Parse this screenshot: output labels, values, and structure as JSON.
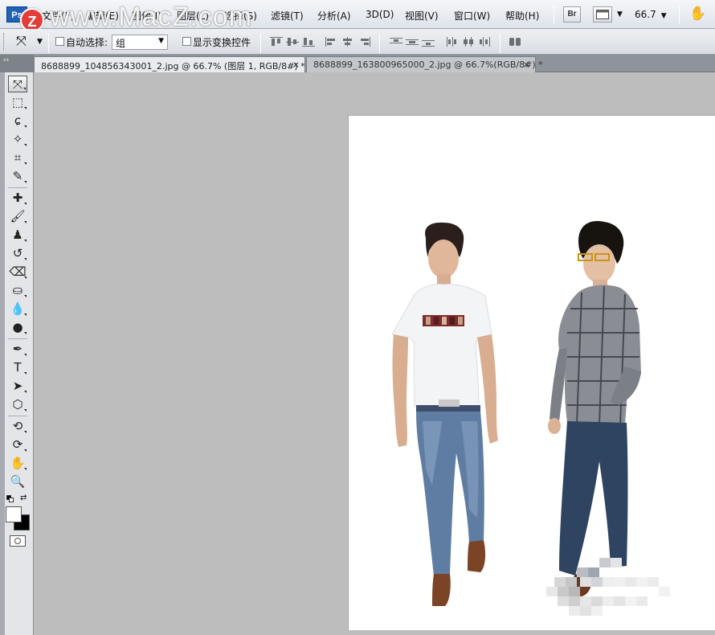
{
  "app": {
    "logo_text": "Ps",
    "zoom_value": "66.7"
  },
  "watermark": {
    "badge": "Z",
    "text": "www.MacZ.com"
  },
  "menu": {
    "items": [
      "文件(F)",
      "编辑(E)",
      "图像(I)",
      "图层(L)",
      "选择(S)",
      "滤镜(T)",
      "分析(A)",
      "3D(D)",
      "视图(V)",
      "窗口(W)",
      "帮助(H)"
    ]
  },
  "appbar": {
    "bridge_label": "Br"
  },
  "options": {
    "auto_select_label": "自动选择:",
    "auto_select_value": "组",
    "transform_label": "显示变换控件"
  },
  "tabs": [
    {
      "label": "8688899_104856343001_2.jpg @ 66.7% (图层 1, RGB/8#) *",
      "close": "×"
    },
    {
      "label": "8688899_163800965000_2.jpg @ 66.7%(RGB/8#) *",
      "close": "×"
    }
  ],
  "toolbox": {
    "header": "››",
    "tools": [
      {
        "name": "move-tool",
        "glyph": "⤧"
      },
      {
        "name": "marquee-tool",
        "glyph": "⬚"
      },
      {
        "name": "lasso-tool",
        "glyph": "ɕ"
      },
      {
        "name": "magic-wand-tool",
        "glyph": "✧"
      },
      {
        "name": "crop-tool",
        "glyph": "⌗"
      },
      {
        "name": "eyedropper-tool",
        "glyph": "✎"
      },
      {
        "name": "healing-brush-tool",
        "glyph": "✚"
      },
      {
        "name": "brush-tool",
        "glyph": "🖌"
      },
      {
        "name": "clone-stamp-tool",
        "glyph": "♟"
      },
      {
        "name": "history-brush-tool",
        "glyph": "↺"
      },
      {
        "name": "eraser-tool",
        "glyph": "⌫"
      },
      {
        "name": "paint-bucket-tool",
        "glyph": "⛀"
      },
      {
        "name": "blur-tool",
        "glyph": "💧"
      },
      {
        "name": "dodge-tool",
        "glyph": "●"
      },
      {
        "name": "pen-tool",
        "glyph": "✒"
      },
      {
        "name": "type-tool",
        "glyph": "T"
      },
      {
        "name": "path-selection-tool",
        "glyph": "➤"
      },
      {
        "name": "shape-tool",
        "glyph": "⬡"
      },
      {
        "name": "3d-rotate-tool",
        "glyph": "⟲"
      },
      {
        "name": "3d-orbit-tool",
        "glyph": "⟳"
      },
      {
        "name": "hand-tool",
        "glyph": "✋"
      },
      {
        "name": "zoom-tool",
        "glyph": "🔍"
      }
    ]
  },
  "colors": {
    "foreground": "#ffffff",
    "background": "#000000"
  }
}
